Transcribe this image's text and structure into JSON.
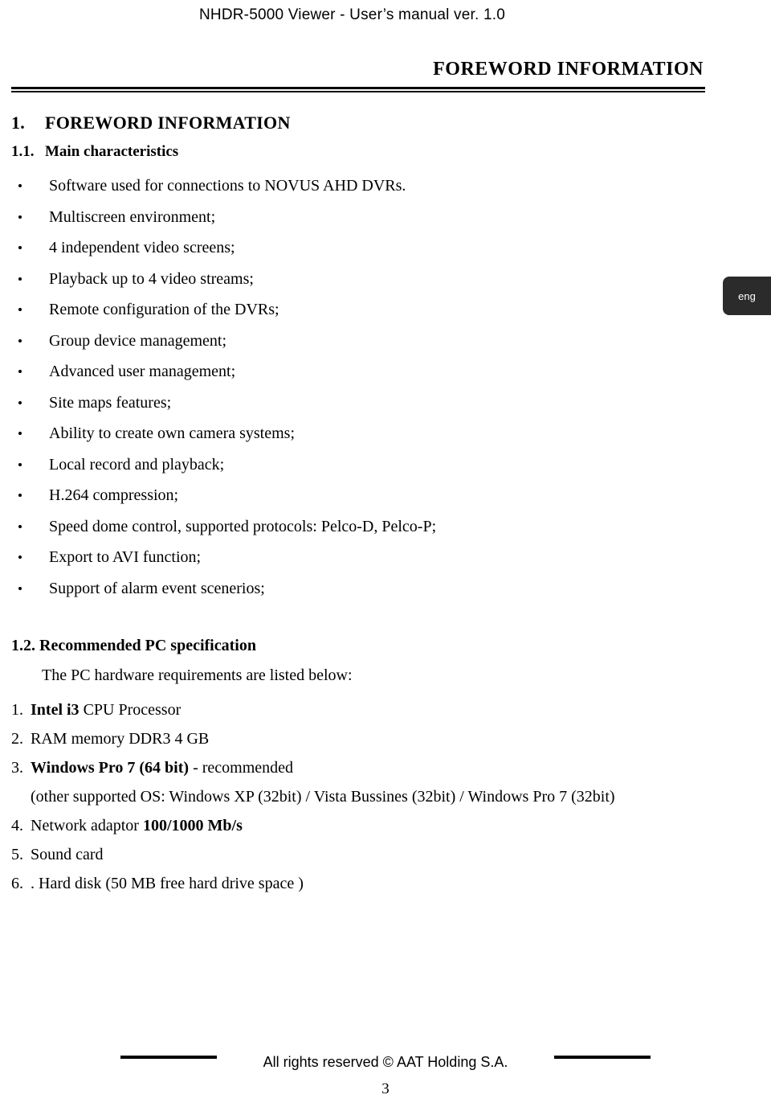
{
  "header": {
    "title": "NHDR-5000 Viewer - User’s manual ver. 1.0"
  },
  "section_title": "FOREWORD INFORMATION",
  "side_tab": {
    "label": "eng"
  },
  "headings": {
    "h1_number": "1.",
    "h1_text": "FOREWORD INFORMATION",
    "h2_number": "1.1.",
    "h2_text": "Main characteristics"
  },
  "features": [
    "Software used for connections to NOVUS AHD DVRs.",
    "Multiscreen environment;",
    "4 independent video screens;",
    "Playback up to 4 video streams;",
    "Remote configuration of the DVRs;",
    "Group device management;",
    "Advanced user management;",
    "Site maps features;",
    "Ability to create own camera systems;",
    "Local record and playback;",
    "H.264 compression;",
    "Speed dome control, supported protocols: Pelco-D, Pelco-P;",
    "Export to AVI function;",
    "Support of alarm event scenerios;"
  ],
  "spec_section": {
    "heading": "1.2. Recommended PC specification",
    "intro": "The PC hardware requirements are listed below:",
    "items": [
      {
        "index": "1.",
        "bold": "Intel i3",
        "rest": " CPU Processor",
        "sub": ""
      },
      {
        "index": "2.",
        "bold": "",
        "rest": "RAM memory DDR3 4 GB",
        "sub": ""
      },
      {
        "index": "3.",
        "bold": "Windows Pro 7 (64 bit)",
        "rest": " - recommended",
        "sub": "(other supported OS: Windows XP (32bit) / Vista Bussines (32bit) / Windows Pro 7 (32bit)"
      },
      {
        "index": "4.",
        "bold": "",
        "rest": "Network adaptor ",
        "bold2": "100/1000 Mb/s",
        "sub": ""
      },
      {
        "index": "5.",
        "bold": "",
        "rest": "Sound card",
        "sub": ""
      },
      {
        "index": "6.",
        "bold": "",
        "rest": ". Hard disk (50 MB free hard drive space )",
        "sub": ""
      }
    ]
  },
  "footer": {
    "text": "All rights reserved © AAT Holding S.A.",
    "page_number": "3"
  }
}
